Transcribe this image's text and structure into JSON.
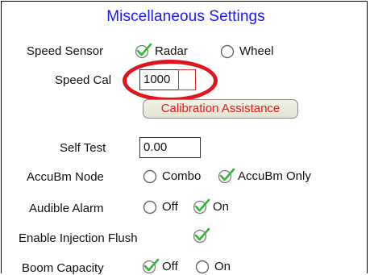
{
  "title": "Miscellaneous Settings",
  "speed_sensor": {
    "label": "Speed Sensor",
    "options": [
      "Radar",
      "Wheel"
    ],
    "selected": "Radar"
  },
  "speed_cal": {
    "label": "Speed Cal",
    "value": "1000"
  },
  "calibration_button": "Calibration Assistance",
  "self_test": {
    "label": "Self Test",
    "value": "0.00"
  },
  "accubm_node": {
    "label": "AccuBm Node",
    "options": [
      "Combo",
      "AccuBm Only"
    ],
    "selected": "AccuBm Only"
  },
  "audible_alarm": {
    "label": "Audible Alarm",
    "options": [
      "Off",
      "On"
    ],
    "selected": "On"
  },
  "injection_flush": {
    "label": "Enable Injection Flush",
    "checked": true
  },
  "boom_capacity": {
    "label": "Boom Capacity",
    "options": [
      "Off",
      "On"
    ],
    "selected": "Off"
  },
  "colors": {
    "title": "#1a1aff",
    "highlight": "#e0141e",
    "check": "#2fb82f"
  },
  "icons": {
    "selected": "green-checkmark-radio-icon",
    "unselected": "radio-circle-icon"
  }
}
